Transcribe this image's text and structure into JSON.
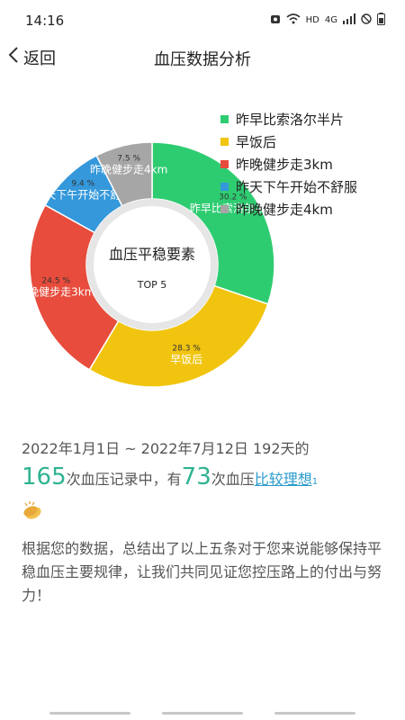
{
  "status_bar": {
    "time": "14:16",
    "network": "HD",
    "signal_tech": "4G"
  },
  "nav": {
    "back_label": "返回",
    "title": "血压数据分析"
  },
  "chart_data": {
    "type": "pie",
    "center_title": "血压平稳要素",
    "center_subtitle": "TOP 5",
    "slices": [
      {
        "label": "昨早比索洛尔半片",
        "short": "昨早比索洛尔半片",
        "percent": 30.2,
        "percent_text": "30.2 %",
        "color": "#2ecc71"
      },
      {
        "label": "早饭后",
        "short": "早饭后",
        "percent": 28.3,
        "percent_text": "28.3 %",
        "color": "#f1c40f"
      },
      {
        "label": "昨晚健步走3km",
        "short": "昨晚健步走3km",
        "percent": 24.5,
        "percent_text": "24.5 %",
        "color": "#e74c3c"
      },
      {
        "label": "昨天下午开始不舒服",
        "short": "昨天下午开始不舒服",
        "percent": 9.4,
        "percent_text": "9.4 %",
        "color": "#3498db"
      },
      {
        "label": "昨晚健步走4km",
        "short": "昨晚健步走4km",
        "percent": 7.5,
        "percent_text": "7.5 %",
        "color": "#a6a6a6"
      }
    ]
  },
  "summary": {
    "date_range": "2022年1月1日 ~ 2022年7月12日 192天的",
    "total_count": "165",
    "text_mid": "次血压记录中，有",
    "ideal_count": "73",
    "text_end": "次血压",
    "link_label": "比较理想",
    "footnote": "1"
  },
  "description": "根据您的数据，总结出了以上五条对于您来说能够保持平稳血压主要规律，让我们共同见证您控压路上的付出与努力！"
}
